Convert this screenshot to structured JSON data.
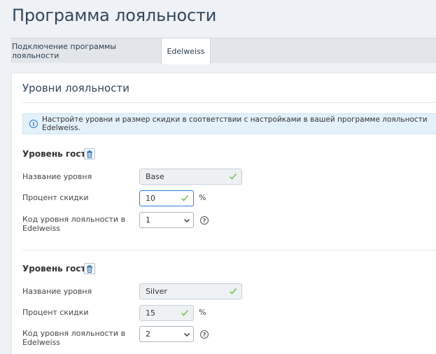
{
  "page": {
    "title": "Программа лояльности"
  },
  "tabs": [
    {
      "label": "Подключение программы лояльности",
      "active": false
    },
    {
      "label": "Edelweiss",
      "active": true
    }
  ],
  "section": {
    "title": "Уровни лояльности"
  },
  "info": {
    "text": "Настройте уровни и размер скидки в соответствии с настройками в вашей программе лояльности Edelweiss.",
    "icon": "info-icon"
  },
  "levels": [
    {
      "title": "Уровень гостя",
      "name_label": "Название уровня",
      "name_value": "Base",
      "discount_label": "Процент скидки",
      "discount_value": "10",
      "discount_unit": "%",
      "code_label_line1": "Код уровня лояльности в",
      "code_label_line2": "Edelweiss",
      "code_value": "1"
    },
    {
      "title": "Уровень гостя",
      "name_label": "Название уровня",
      "name_value": "Silver",
      "discount_label": "Процент скидки",
      "discount_value": "15",
      "discount_unit": "%",
      "code_label_line1": "Код уровня лояльности в",
      "code_label_line2": "Edelweiss",
      "code_value": "2"
    }
  ],
  "colors": {
    "accent": "#2f7dcc",
    "check": "#6cc04a",
    "title": "#34475a"
  }
}
